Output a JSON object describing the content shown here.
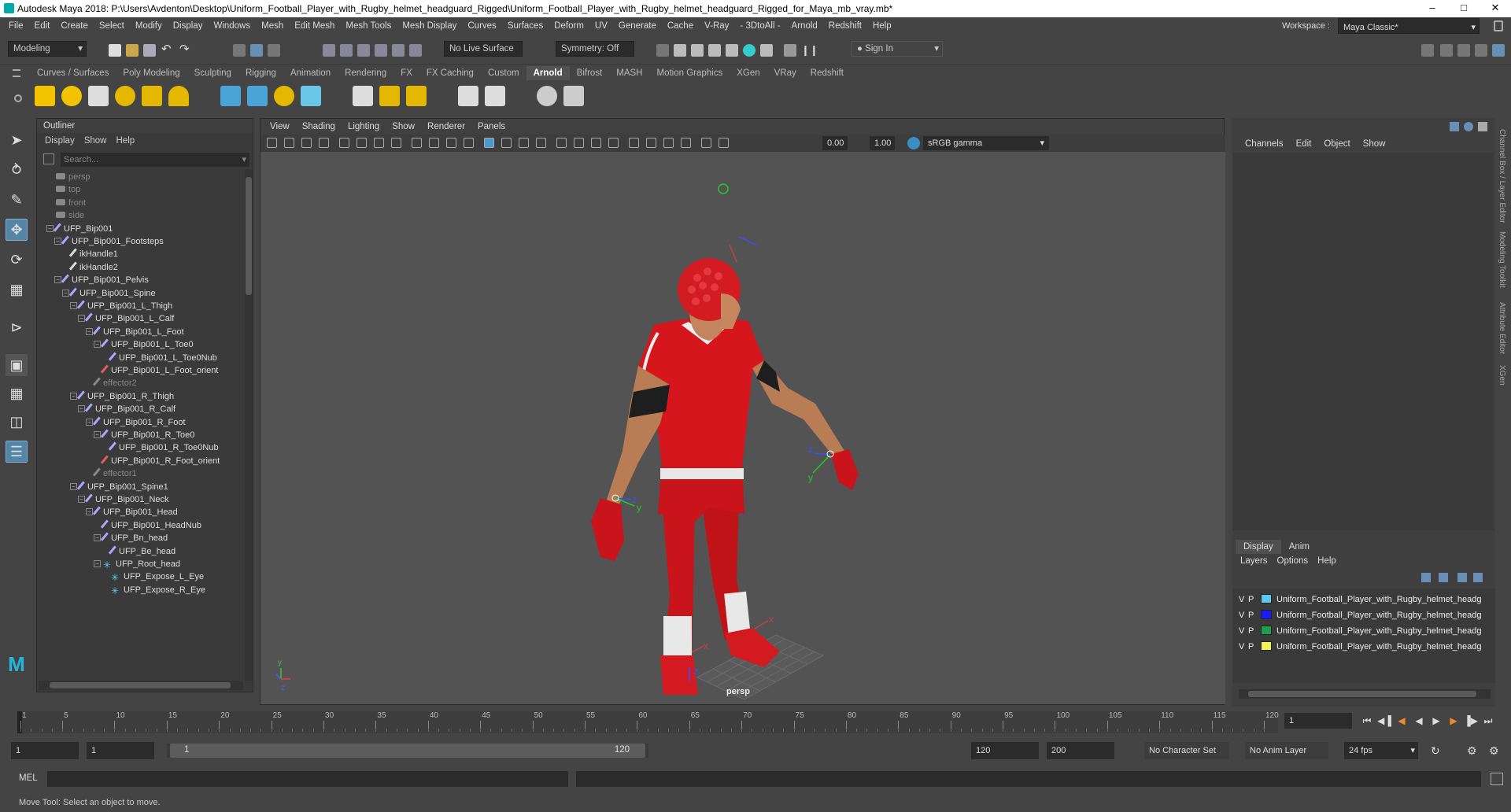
{
  "window": {
    "title": "Autodesk Maya 2018: P:\\Users\\Avdenton\\Desktop\\Uniform_Football_Player_with_Rugby_helmet_headguard_Rigged\\Uniform_Football_Player_with_Rugby_helmet_headguard_Rigged_for_Maya_mb_vray.mb*"
  },
  "menubar": [
    "File",
    "Edit",
    "Create",
    "Select",
    "Modify",
    "Display",
    "Windows",
    "Mesh",
    "Edit Mesh",
    "Mesh Tools",
    "Mesh Display",
    "Curves",
    "Surfaces",
    "Deform",
    "UV",
    "Generate",
    "Cache",
    "V-Ray",
    "- 3DtoAll -",
    "Arnold",
    "Redshift",
    "Help"
  ],
  "workspace": {
    "label": "Workspace :",
    "value": "Maya Classic*"
  },
  "statusline": {
    "mode": "Modeling",
    "live_surface": "No Live Surface",
    "symmetry": "Symmetry: Off",
    "sign_in": "Sign In"
  },
  "shelf_tabs": [
    "Curves / Surfaces",
    "Poly Modeling",
    "Sculpting",
    "Rigging",
    "Animation",
    "Rendering",
    "FX",
    "FX Caching",
    "Custom",
    "Arnold",
    "Bifrost",
    "MASH",
    "Motion Graphics",
    "XGen",
    "VRay",
    "Redshift"
  ],
  "shelf_active": "Arnold",
  "outliner": {
    "title": "Outliner",
    "menu": [
      "Display",
      "Show",
      "Help"
    ],
    "search_placeholder": "Search...",
    "items": [
      {
        "label": "persp",
        "depth": 0,
        "type": "camera",
        "dim": true
      },
      {
        "label": "top",
        "depth": 0,
        "type": "camera",
        "dim": true
      },
      {
        "label": "front",
        "depth": 0,
        "type": "camera",
        "dim": true
      },
      {
        "label": "side",
        "depth": 0,
        "type": "camera",
        "dim": true
      },
      {
        "label": "UFP_Bip001",
        "depth": 0,
        "type": "joint",
        "exp": "-"
      },
      {
        "label": "UFP_Bip001_Footsteps",
        "depth": 1,
        "type": "joint",
        "exp": "-"
      },
      {
        "label": "ikHandle1",
        "depth": 2,
        "type": "ik"
      },
      {
        "label": "ikHandle2",
        "depth": 2,
        "type": "ik"
      },
      {
        "label": "UFP_Bip001_Pelvis",
        "depth": 1,
        "type": "joint",
        "exp": "-"
      },
      {
        "label": "UFP_Bip001_Spine",
        "depth": 2,
        "type": "joint",
        "exp": "-"
      },
      {
        "label": "UFP_Bip001_L_Thigh",
        "depth": 3,
        "type": "joint",
        "exp": "-"
      },
      {
        "label": "UFP_Bip001_L_Calf",
        "depth": 4,
        "type": "joint",
        "exp": "-"
      },
      {
        "label": "UFP_Bip001_L_Foot",
        "depth": 5,
        "type": "joint",
        "exp": "-"
      },
      {
        "label": "UFP_Bip001_L_Toe0",
        "depth": 6,
        "type": "joint",
        "exp": "-"
      },
      {
        "label": "UFP_Bip001_L_Toe0Nub",
        "depth": 7,
        "type": "joint"
      },
      {
        "label": "UFP_Bip001_L_Foot_orient",
        "depth": 6,
        "type": "constraint"
      },
      {
        "label": "effector2",
        "depth": 5,
        "type": "effector",
        "dim": true
      },
      {
        "label": "UFP_Bip001_R_Thigh",
        "depth": 3,
        "type": "joint",
        "exp": "-"
      },
      {
        "label": "UFP_Bip001_R_Calf",
        "depth": 4,
        "type": "joint",
        "exp": "-"
      },
      {
        "label": "UFP_Bip001_R_Foot",
        "depth": 5,
        "type": "joint",
        "exp": "-"
      },
      {
        "label": "UFP_Bip001_R_Toe0",
        "depth": 6,
        "type": "joint",
        "exp": "-"
      },
      {
        "label": "UFP_Bip001_R_Toe0Nub",
        "depth": 7,
        "type": "joint"
      },
      {
        "label": "UFP_Bip001_R_Foot_orient",
        "depth": 6,
        "type": "constraint"
      },
      {
        "label": "effector1",
        "depth": 5,
        "type": "effector",
        "dim": true
      },
      {
        "label": "UFP_Bip001_Spine1",
        "depth": 3,
        "type": "joint",
        "exp": "-"
      },
      {
        "label": "UFP_Bip001_Neck",
        "depth": 4,
        "type": "joint",
        "exp": "-"
      },
      {
        "label": "UFP_Bip001_Head",
        "depth": 5,
        "type": "joint",
        "exp": "-"
      },
      {
        "label": "UFP_Bip001_HeadNub",
        "depth": 6,
        "type": "joint"
      },
      {
        "label": "UFP_Bn_head",
        "depth": 6,
        "type": "joint",
        "exp": "-"
      },
      {
        "label": "UFP_Be_head",
        "depth": 7,
        "type": "joint"
      },
      {
        "label": "UFP_Root_head",
        "depth": 6,
        "type": "locator",
        "exp": "-"
      },
      {
        "label": "UFP_Expose_L_Eye",
        "depth": 7,
        "type": "locator"
      },
      {
        "label": "UFP_Expose_R_Eye",
        "depth": 7,
        "type": "locator"
      }
    ]
  },
  "viewport": {
    "menu": [
      "View",
      "Shading",
      "Lighting",
      "Show",
      "Renderer",
      "Panels"
    ],
    "field1": "0.00",
    "field2": "1.00",
    "colorspace": "sRGB gamma",
    "camera_label": "persp"
  },
  "channelbox": {
    "menu": [
      "Channels",
      "Edit",
      "Object",
      "Show"
    ]
  },
  "layers": {
    "tabs": [
      "Display",
      "Anim"
    ],
    "menu": [
      "Layers",
      "Options",
      "Help"
    ],
    "items": [
      {
        "v": "V",
        "p": "P",
        "color": "#5bc8f0",
        "name": "Uniform_Football_Player_with_Rugby_helmet_headg"
      },
      {
        "v": "V",
        "p": "P",
        "color": "#1a1aff",
        "name": "Uniform_Football_Player_with_Rugby_helmet_headg"
      },
      {
        "v": "V",
        "p": "P",
        "color": "#1e9e4a",
        "name": "Uniform_Football_Player_with_Rugby_helmet_headg"
      },
      {
        "v": "V",
        "p": "P",
        "color": "#f2f25a",
        "name": "Uniform_Football_Player_with_Rugby_helmet_headg"
      }
    ]
  },
  "side_tabs": [
    "Channel Box / Layer Editor",
    "Modeling Toolkit",
    "Attribute Editor",
    "XGen"
  ],
  "timeline": {
    "ticks": [
      "1",
      "5",
      "10",
      "15",
      "20",
      "25",
      "30",
      "35",
      "40",
      "45",
      "50",
      "55",
      "60",
      "65",
      "70",
      "75",
      "80",
      "85",
      "90",
      "95",
      "100",
      "105",
      "110",
      "115",
      "120"
    ],
    "current": "1"
  },
  "range": {
    "start": "1",
    "start2": "1",
    "slider_start": "1",
    "slider_end": "120",
    "end": "120",
    "end2": "200",
    "char_set": "No Character Set",
    "anim_layer": "No Anim Layer",
    "fps": "24 fps"
  },
  "cmdline": {
    "label": "MEL"
  },
  "helpline": "Move Tool: Select an object to move."
}
